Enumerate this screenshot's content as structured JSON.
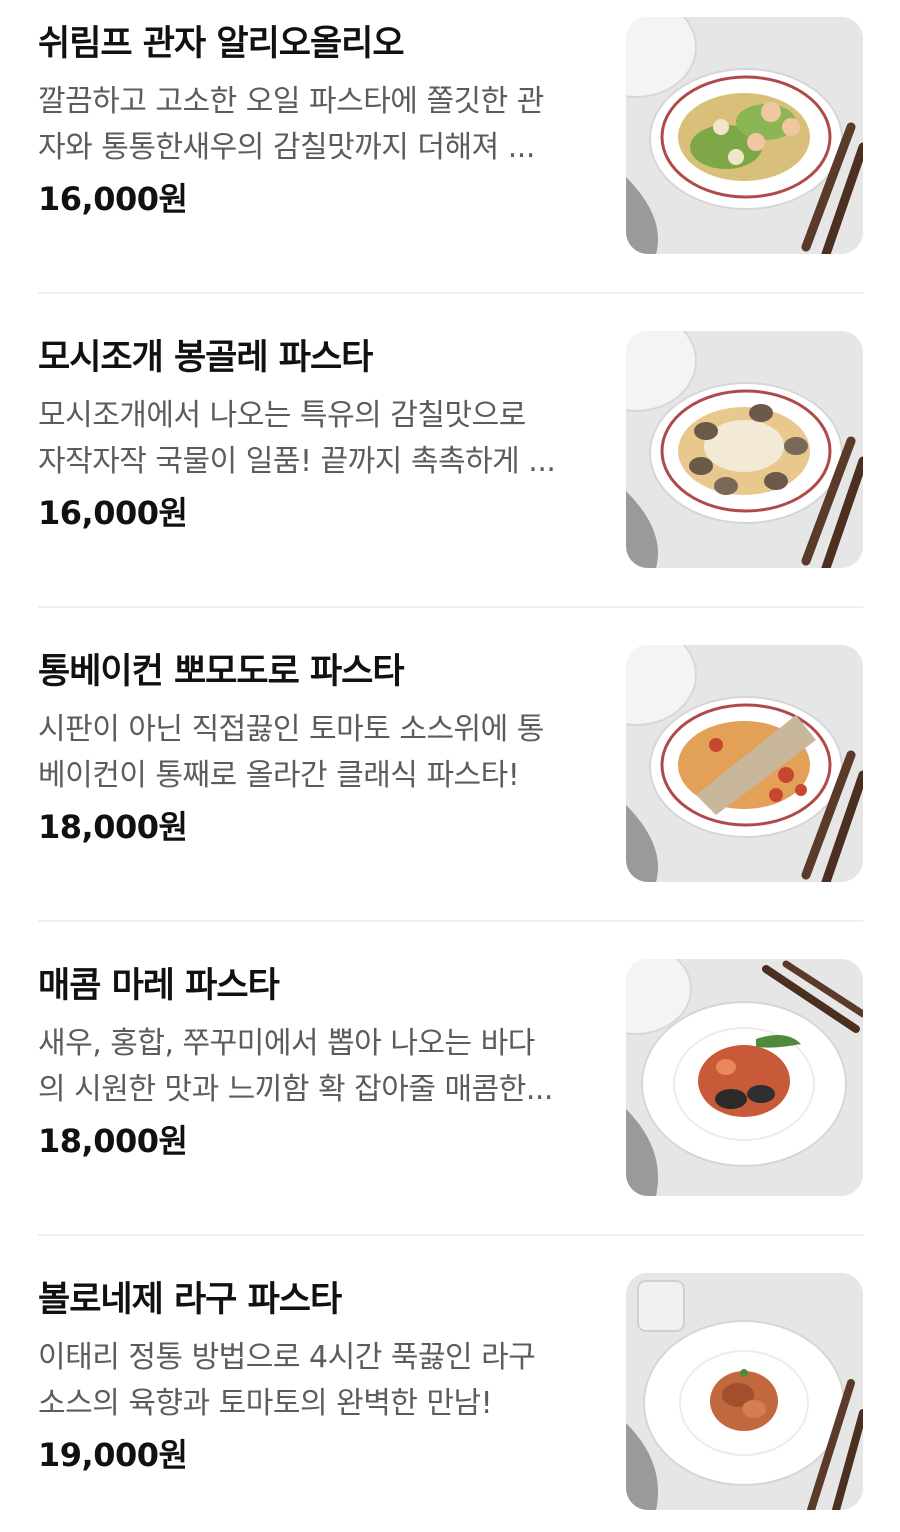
{
  "menu": {
    "items": [
      {
        "name": "쉬림프 관자 알리오올리오",
        "desc_line1": "깔끔하고 고소한 오일 파스타에 쫄깃한 관",
        "desc_line2": "자와 통통한새우의 감칠맛까지 더해져 ...",
        "price": "16,000원",
        "photo": "shrimp-scallop-aglio-olio-photo"
      },
      {
        "name": "모시조개 봉골레 파스타",
        "desc_line1": "모시조개에서 나오는 특유의 감칠맛으로",
        "desc_line2": "자작자작 국물이 일품! 끝까지 촉촉하게 ...",
        "price": "16,000원",
        "photo": "clam-vongole-pasta-photo"
      },
      {
        "name": "통베이컨 뽀모도로 파스타",
        "desc_line1": "시판이 아닌 직접끓인 토마토 소스위에 통",
        "desc_line2": "베이컨이 통째로 올라간 클래식 파스타!",
        "price": "18,000원",
        "photo": "bacon-pomodoro-pasta-photo"
      },
      {
        "name": "매콤 마레 파스타",
        "desc_line1": "새우, 홍합, 쭈꾸미에서 뽑아 나오는 바다",
        "desc_line2": "의 시원한 맛과 느끼함 확 잡아줄 매콤한...",
        "price": "18,000원",
        "photo": "spicy-mare-pasta-photo"
      },
      {
        "name": "볼로네제 라구 파스타",
        "desc_line1": "이태리 정통 방법으로 4시간 푹끓인 라구",
        "desc_line2": "소스의 육향과 토마토의 완벽한 만남!",
        "price": "19,000원",
        "photo": "bolognese-ragu-pasta-photo"
      }
    ]
  },
  "colors": {
    "name_text": "#111111",
    "desc_text": "#5c5c5c",
    "divider": "#f0f0f0",
    "photo_background": "#e4e4e4"
  }
}
